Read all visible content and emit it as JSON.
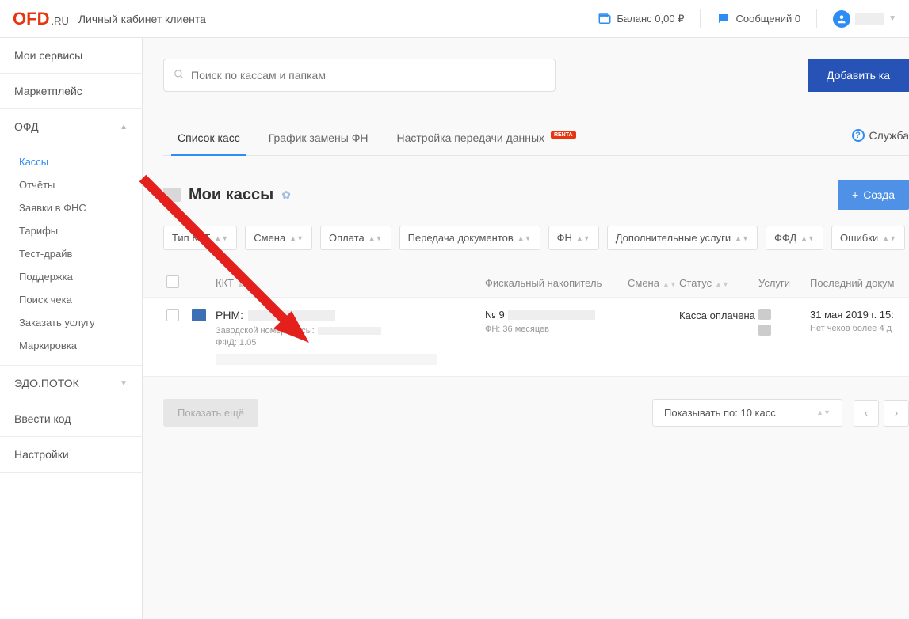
{
  "header": {
    "logo_o": "O",
    "logo_fd": "FD",
    "logo_ru": ".RU",
    "subtitle": "Личный кабинет клиента",
    "balance_label": "Баланс 0,00 ₽",
    "messages_label": "Сообщений 0"
  },
  "sidebar": {
    "groups": [
      {
        "label": "Мои сервисы",
        "expandable": false
      },
      {
        "label": "Маркетплейс",
        "expandable": false
      },
      {
        "label": "ОФД",
        "expandable": true,
        "expanded": true,
        "items": [
          "Кассы",
          "Отчёты",
          "Заявки в ФНС",
          "Тарифы",
          "Тест-драйв",
          "Поддержка",
          "Поиск чека",
          "Заказать услугу",
          "Маркировка"
        ],
        "active_index": 0
      },
      {
        "label": "ЭДО.ПОТОК",
        "expandable": true,
        "expanded": false
      },
      {
        "label": "Ввести код",
        "expandable": false
      },
      {
        "label": "Настройки",
        "expandable": false
      }
    ]
  },
  "search": {
    "placeholder": "Поиск по кассам и папкам"
  },
  "buttons": {
    "add_kkt": "Добавить ка",
    "create": "Созда",
    "show_more": "Показать ещё"
  },
  "tabs": {
    "items": [
      {
        "label": "Список касс",
        "active": true
      },
      {
        "label": "График замены ФН"
      },
      {
        "label": "Настройка передачи данных",
        "badge": "RENTA"
      }
    ],
    "help_label": "Служба"
  },
  "section": {
    "title": "Мои кассы"
  },
  "filters": [
    "Тип ККТ",
    "Смена",
    "Оплата",
    "Передача документов",
    "ФН",
    "Дополнительные услуги",
    "ФФД",
    "Ошибки"
  ],
  "table": {
    "headers": {
      "kkt": "ККТ",
      "fn": "Фискальный накопитель",
      "smena": "Смена",
      "status": "Статус",
      "services": "Услуги",
      "last_doc": "Последний докум"
    },
    "rows": [
      {
        "rnm_label": "РНМ:",
        "factory_label": "Заводской номер кассы:",
        "ffd": "ФФД: 1.05",
        "fn_prefix": "№ 9",
        "fn_duration": "ФН: 36 месяцев",
        "status": "Касса оплачена",
        "date": "31 мая 2019 г. 15:",
        "date_sub": "Нет чеков более 4 д"
      }
    ]
  },
  "pagination": {
    "perpage_label": "Показывать по: 10 касс"
  }
}
